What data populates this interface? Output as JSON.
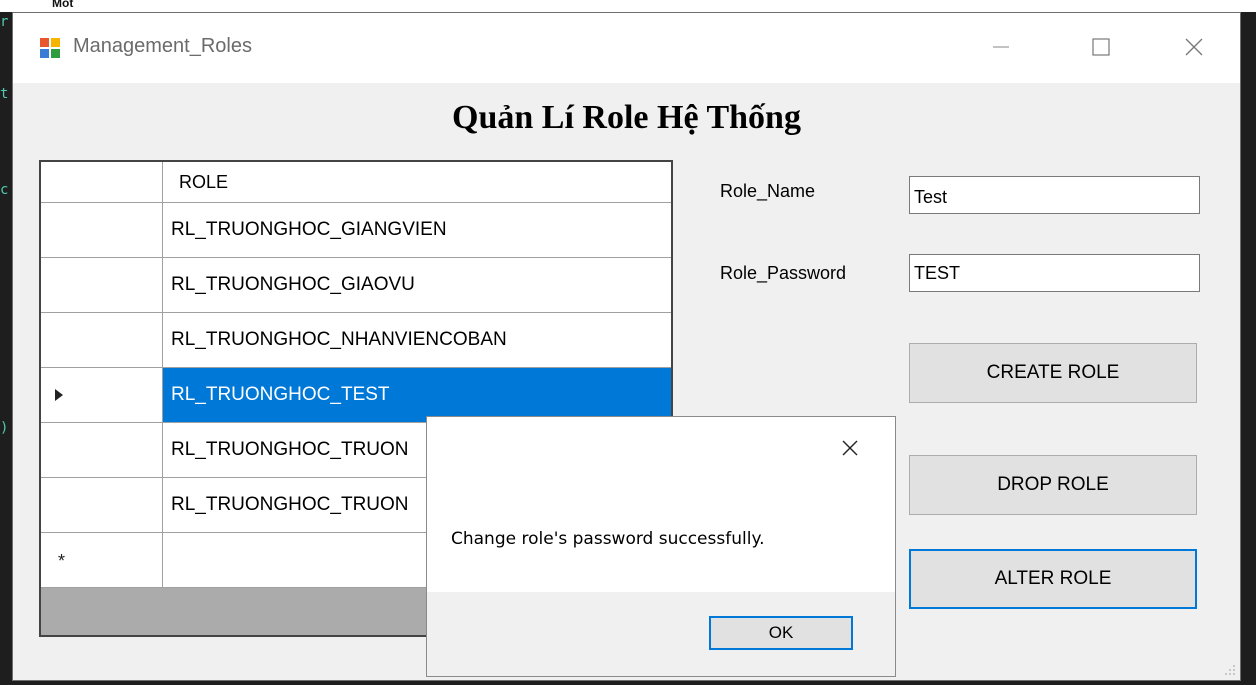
{
  "background": {
    "top_text": "Mot",
    "glyphs": [
      "r",
      "t",
      "c",
      ")"
    ]
  },
  "window": {
    "title": "Management_Roles",
    "controls": {
      "minimize": "minimize-icon",
      "maximize": "maximize-icon",
      "close": "close-icon"
    }
  },
  "heading": "Quản Lí Role Hệ Thống",
  "grid": {
    "column_header": "ROLE",
    "rows": [
      {
        "role": "RL_TRUONGHOC_GIANGVIEN",
        "selected": false
      },
      {
        "role": "RL_TRUONGHOC_GIAOVU",
        "selected": false
      },
      {
        "role": "RL_TRUONGHOC_NHANVIENCOBAN",
        "selected": false
      },
      {
        "role": "RL_TRUONGHOC_TEST",
        "selected": true
      },
      {
        "role": "RL_TRUONGHOC_TRUON",
        "selected": false
      },
      {
        "role": "RL_TRUONGHOC_TRUON",
        "selected": false
      }
    ],
    "new_row_marker": "*"
  },
  "form": {
    "role_name_label": "Role_Name",
    "role_name_value": "Test",
    "role_password_label": "Role_Password",
    "role_password_value": "TEST",
    "create_button": "CREATE ROLE",
    "drop_button": "DROP ROLE",
    "alter_button": "ALTER ROLE"
  },
  "dialog": {
    "message": "Change role's password successfully.",
    "ok_button": "OK"
  },
  "colors": {
    "selection": "#0078d7",
    "focus_border": "#0078d7",
    "window_bg": "#f0f0f0"
  }
}
